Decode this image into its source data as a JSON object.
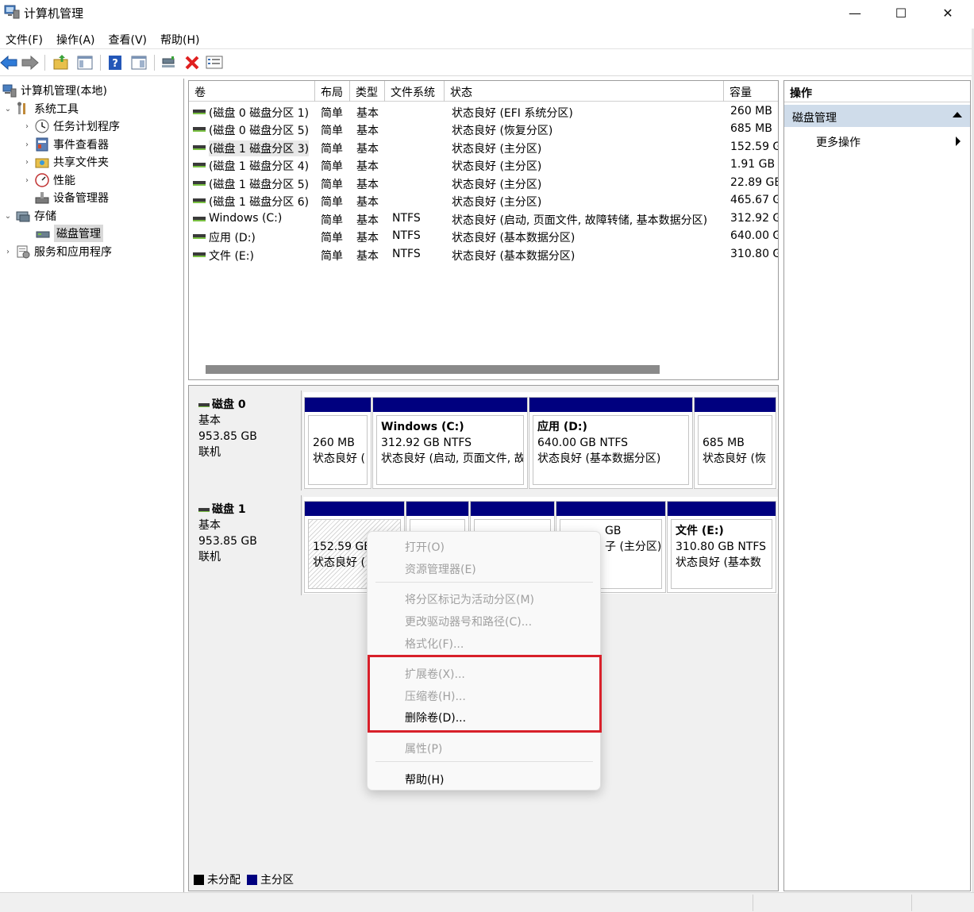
{
  "window": {
    "title": "计算机管理",
    "minimize_glyph": "—",
    "maximize_glyph": "☐",
    "close_glyph": "✕"
  },
  "menu": [
    "文件(F)",
    "操作(A)",
    "查看(V)",
    "帮助(H)"
  ],
  "toolbar": {
    "icons": [
      "back-arrow-icon",
      "forward-arrow-icon",
      "up-folder-icon",
      "console-tree-icon",
      "help-icon",
      "view-icon",
      "connect-icon",
      "delete-icon",
      "properties-icon"
    ],
    "colors": {
      "arrow": "#2f7bd8",
      "delete": "#e02020",
      "help": "#2457b8"
    }
  },
  "tree": {
    "root": "计算机管理(本地)",
    "system_tools": "系统工具",
    "task_scheduler": "任务计划程序",
    "event_viewer": "事件查看器",
    "shared_folders": "共享文件夹",
    "performance": "性能",
    "device_manager": "设备管理器",
    "storage": "存储",
    "disk_management": "磁盘管理",
    "services_apps": "服务和应用程序"
  },
  "volume_list": {
    "columns": [
      "卷",
      "布局",
      "类型",
      "文件系统",
      "状态",
      "容量"
    ],
    "rows": [
      {
        "volume": "(磁盘 0 磁盘分区 1)",
        "layout": "简单",
        "type": "基本",
        "fs": "",
        "status": "状态良好 (EFI 系统分区)",
        "capacity": "260 MB"
      },
      {
        "volume": "(磁盘 0 磁盘分区 5)",
        "layout": "简单",
        "type": "基本",
        "fs": "",
        "status": "状态良好 (恢复分区)",
        "capacity": "685 MB"
      },
      {
        "volume": "(磁盘 1 磁盘分区 3)",
        "layout": "简单",
        "type": "基本",
        "fs": "",
        "status": "状态良好 (主分区)",
        "capacity": "152.59 G"
      },
      {
        "volume": "(磁盘 1 磁盘分区 4)",
        "layout": "简单",
        "type": "基本",
        "fs": "",
        "status": "状态良好 (主分区)",
        "capacity": "1.91 GB"
      },
      {
        "volume": "(磁盘 1 磁盘分区 5)",
        "layout": "简单",
        "type": "基本",
        "fs": "",
        "status": "状态良好 (主分区)",
        "capacity": "22.89 GE"
      },
      {
        "volume": "(磁盘 1 磁盘分区 6)",
        "layout": "简单",
        "type": "基本",
        "fs": "",
        "status": "状态良好 (主分区)",
        "capacity": "465.67 G"
      },
      {
        "volume": "Windows (C:)",
        "layout": "简单",
        "type": "基本",
        "fs": "NTFS",
        "status": "状态良好 (启动, 页面文件, 故障转储, 基本数据分区)",
        "capacity": "312.92 G"
      },
      {
        "volume": "应用 (D:)",
        "layout": "简单",
        "type": "基本",
        "fs": "NTFS",
        "status": "状态良好 (基本数据分区)",
        "capacity": "640.00 G"
      },
      {
        "volume": "文件 (E:)",
        "layout": "简单",
        "type": "基本",
        "fs": "NTFS",
        "status": "状态良好 (基本数据分区)",
        "capacity": "310.80 G"
      }
    ]
  },
  "disks": [
    {
      "name": "磁盘 0",
      "kind": "基本",
      "size": "953.85 GB",
      "state": "联机",
      "partitions": [
        {
          "name": "",
          "size": "260 MB",
          "status": "状态良好 (",
          "hatched": false
        },
        {
          "name": "Windows  (C:)",
          "size": "312.92 GB NTFS",
          "status": "状态良好 (启动, 页面文件, 故",
          "hatched": false
        },
        {
          "name": "应用  (D:)",
          "size": "640.00 GB NTFS",
          "status": "状态良好 (基本数据分区)",
          "hatched": false
        },
        {
          "name": "",
          "size": "685 MB",
          "status": "状态良好 (恢",
          "hatched": false
        }
      ]
    },
    {
      "name": "磁盘 1",
      "kind": "基本",
      "size": "953.85 GB",
      "state": "联机",
      "partitions": [
        {
          "name": "",
          "size": "152.59 GB",
          "status": "状态良好 (",
          "hatched": true
        },
        {
          "name": "",
          "size": "",
          "status": "",
          "hatched": false
        },
        {
          "name": "",
          "size": "",
          "status": "",
          "hatched": false
        },
        {
          "name": "",
          "size": "GB",
          "status": "子 (主分区)",
          "hatched": false
        },
        {
          "name": "文件  (E:)",
          "size": "310.80 GB NTFS",
          "status": "状态良好 (基本数",
          "hatched": false
        }
      ]
    }
  ],
  "legend": {
    "unallocated": "未分配",
    "primary": "主分区",
    "unallocated_color": "#000000",
    "primary_color": "#00007f"
  },
  "actions": {
    "title": "操作",
    "section": "磁盘管理",
    "more": "更多操作"
  },
  "context_menu": {
    "open": "打开(O)",
    "explore": "资源管理器(E)",
    "mark_active": "将分区标记为活动分区(M)",
    "change_letter": "更改驱动器号和路径(C)...",
    "format": "格式化(F)...",
    "extend": "扩展卷(X)...",
    "shrink": "压缩卷(H)...",
    "delete": "删除卷(D)...",
    "properties": "属性(P)",
    "help": "帮助(H)"
  },
  "highlight_color": "#d8202a"
}
